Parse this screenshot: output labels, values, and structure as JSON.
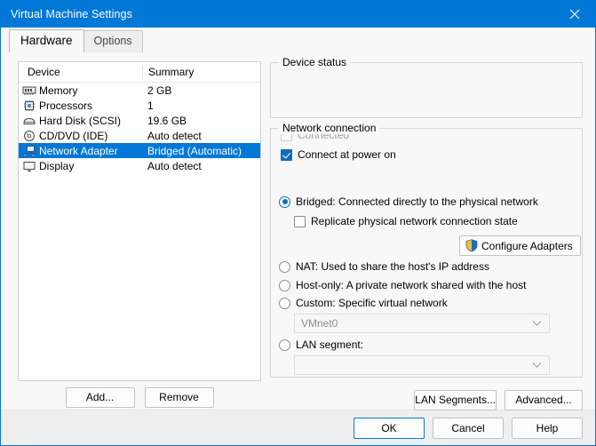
{
  "window": {
    "title": "Virtual Machine Settings",
    "close_icon": "close-icon"
  },
  "tabs": [
    {
      "label": "Hardware",
      "active": true
    },
    {
      "label": "Options",
      "active": false
    }
  ],
  "device_list": {
    "columns": [
      "Device",
      "Summary"
    ],
    "rows": [
      {
        "icon": "memory-icon",
        "name": "Memory",
        "summary": "2 GB",
        "selected": false
      },
      {
        "icon": "processor-icon",
        "name": "Processors",
        "summary": "1",
        "selected": false
      },
      {
        "icon": "hard-disk-icon",
        "name": "Hard Disk (SCSI)",
        "summary": "19.6 GB",
        "selected": false
      },
      {
        "icon": "cd-dvd-icon",
        "name": "CD/DVD (IDE)",
        "summary": "Auto detect",
        "selected": false
      },
      {
        "icon": "network-adapter-icon",
        "name": "Network Adapter",
        "summary": "Bridged (Automatic)",
        "selected": true
      },
      {
        "icon": "display-icon",
        "name": "Display",
        "summary": "Auto detect",
        "selected": false
      }
    ],
    "add_label": "Add...",
    "remove_label": "Remove"
  },
  "device_status": {
    "title": "Device status",
    "connected_label": "Connected",
    "connected_checked": false,
    "connected_enabled": false,
    "power_on_label": "Connect at power on",
    "power_on_checked": true
  },
  "network_connection": {
    "title": "Network connection",
    "bridged_label": "Bridged: Connected directly to the physical network",
    "replicate_label": "Replicate physical network connection state",
    "configure_adapters_label": "Configure Adapters",
    "nat_label": "NAT: Used to share the host's IP address",
    "host_only_label": "Host-only: A private network shared with the host",
    "custom_label": "Custom: Specific virtual network",
    "custom_value": "VMnet0",
    "lan_segment_label": "LAN segment:",
    "lan_segment_value": "",
    "selected": "bridged",
    "lan_segments_button": "LAN Segments...",
    "advanced_button": "Advanced..."
  },
  "footer": {
    "ok": "OK",
    "cancel": "Cancel",
    "help": "Help"
  },
  "colors": {
    "accent": "#0078d7",
    "selection": "#0078d7",
    "control_blue": "#0f6cbd"
  }
}
